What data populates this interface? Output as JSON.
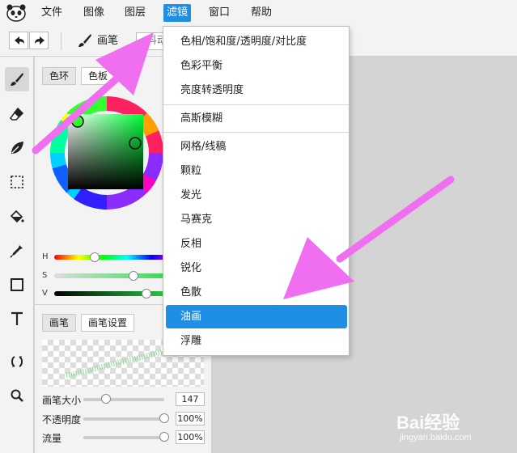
{
  "menubar": {
    "items": [
      "文件",
      "图像",
      "图层",
      "滤镜",
      "窗口",
      "帮助"
    ],
    "active_index": 3
  },
  "toolbar": {
    "brush_label": "画笔",
    "mode_label": "抖动"
  },
  "color_panel": {
    "tabs": [
      "色环",
      "色板"
    ],
    "sliders": {
      "h_label": "H",
      "s_label": "S",
      "v_label": "V",
      "h": 0.33,
      "s": 0.65,
      "v": 0.76
    }
  },
  "brush_panel": {
    "tabs": [
      "画笔",
      "画笔设置"
    ],
    "rows": [
      {
        "label": "画笔大小",
        "value": "147",
        "fraction": 0.28
      },
      {
        "label": "不透明度",
        "value": "100%",
        "fraction": 1.0
      },
      {
        "label": "流量",
        "value": "100%",
        "fraction": 1.0
      }
    ]
  },
  "filter_menu": {
    "items": [
      "色相/饱和度/透明度/对比度",
      "色彩平衡",
      "亮度转透明度",
      "高斯模糊",
      "网格/线稿",
      "颗粒",
      "发光",
      "马赛克",
      "反相",
      "锐化",
      "色散",
      "油画",
      "浮雕"
    ],
    "highlighted": "油画"
  },
  "colors": {
    "accent": "#1f8fe6",
    "arrow": "#f06ef0"
  },
  "watermark": {
    "brand": "Bai经验",
    "site": "jingyan.baidu.com"
  }
}
